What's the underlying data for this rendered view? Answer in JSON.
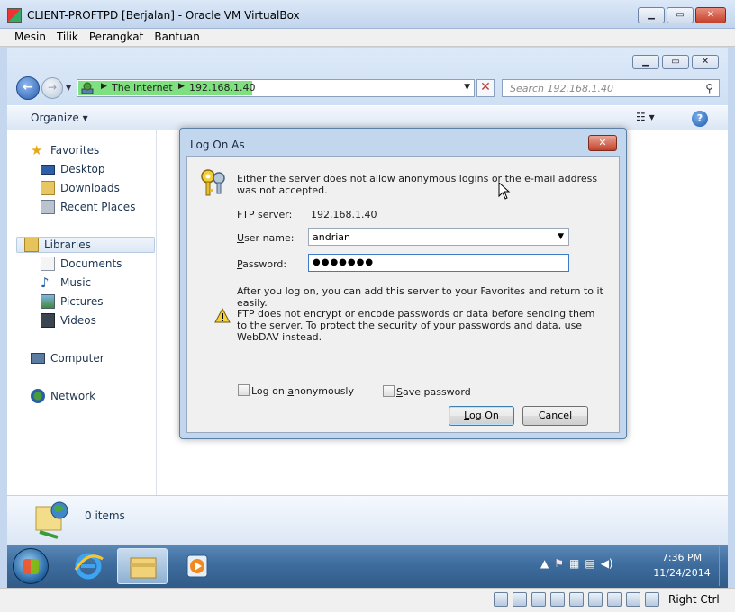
{
  "vbox": {
    "title": "CLIENT-PROFTPD [Berjalan] - Oracle VM VirtualBox",
    "menu": [
      "Mesin",
      "Tilik",
      "Perangkat",
      "Bantuan"
    ],
    "status_right": "Right Ctrl"
  },
  "explorer": {
    "address": [
      "The Internet",
      "192.168.1.40"
    ],
    "search_placeholder": "Search 192.168.1.40",
    "organize": "Organize",
    "nav": {
      "favorites": "Favorites",
      "desktop": "Desktop",
      "downloads": "Downloads",
      "recent": "Recent Places",
      "libraries": "Libraries",
      "documents": "Documents",
      "music": "Music",
      "pictures": "Pictures",
      "videos": "Videos",
      "computer": "Computer",
      "network": "Network"
    },
    "items_count": "0 items"
  },
  "taskbar": {
    "time": "7:36 PM",
    "date": "11/24/2014"
  },
  "dialog": {
    "title": "Log On As",
    "message": "Either the server does not allow anonymous logins or the e-mail address was not accepted.",
    "ftp_server_label": "FTP server:",
    "ftp_server_value": "192.168.1.40",
    "username_label_u": "U",
    "username_label_rest": "ser name:",
    "username_value": "andrian",
    "password_label_u": "P",
    "password_label_rest": "assword:",
    "password_value": "●●●●●●●",
    "after_logon": "After you log on, you can add this server to your Favorites and return to it easily.",
    "warning": "FTP does not encrypt or encode passwords or data before sending them to the server.  To protect the security of your passwords and data, use WebDAV instead.",
    "anon_pre": "Log on ",
    "anon_u": "a",
    "anon_post": "nonymously",
    "save_u": "S",
    "save_post": "ave password",
    "logon_pre": "",
    "logon_u": "L",
    "logon_post": "og On",
    "cancel": "Cancel"
  }
}
